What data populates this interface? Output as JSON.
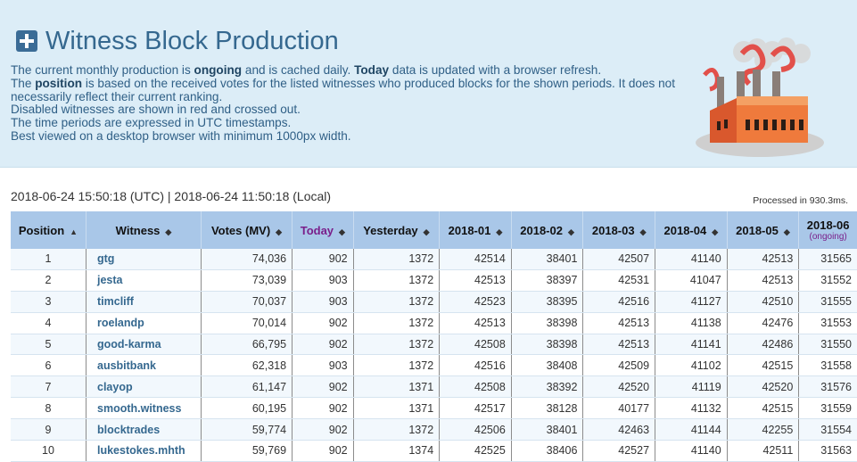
{
  "header": {
    "title": "Witness Block Production",
    "intro": {
      "line1_a": "The current monthly production is ",
      "line1_b": "ongoing",
      "line1_c": " and is cached daily. ",
      "line1_d": "Today",
      "line1_e": " data is updated with a browser refresh.",
      "line2_a": "The ",
      "line2_b": "position",
      "line2_c": " is based on the received votes for the listed witnesses who produced blocks for the shown periods. It does not necessarily reflect their current ranking.",
      "line3": "Disabled witnesses are shown in red and crossed out.",
      "line4": "The time periods are expressed in UTC timestamps.",
      "line5": "Best viewed on a desktop browser with minimum 1000px width."
    }
  },
  "timestamp": "2018-06-24 15:50:18 (UTC) | 2018-06-24 11:50:18 (Local)",
  "processed": "Processed in 930.3ms.",
  "table": {
    "columns": {
      "position": "Position",
      "witness": "Witness",
      "votes": "Votes (MV)",
      "today": "Today",
      "yesterday": "Yesterday",
      "m1": "2018-01",
      "m2": "2018-02",
      "m3": "2018-03",
      "m4": "2018-04",
      "m5": "2018-05",
      "m6": "2018-06",
      "m6_note": "(ongoing)"
    },
    "rows": [
      {
        "pos": "1",
        "witness": "gtg",
        "votes": "74,036",
        "today": "902",
        "yesterday": "1372",
        "m1": "42514",
        "m2": "38401",
        "m3": "42507",
        "m4": "41140",
        "m5": "42513",
        "m6": "31565"
      },
      {
        "pos": "2",
        "witness": "jesta",
        "votes": "73,039",
        "today": "903",
        "yesterday": "1372",
        "m1": "42513",
        "m2": "38397",
        "m3": "42531",
        "m4": "41047",
        "m5": "42513",
        "m6": "31552"
      },
      {
        "pos": "3",
        "witness": "timcliff",
        "votes": "70,037",
        "today": "903",
        "yesterday": "1372",
        "m1": "42523",
        "m2": "38395",
        "m3": "42516",
        "m4": "41127",
        "m5": "42510",
        "m6": "31555"
      },
      {
        "pos": "4",
        "witness": "roelandp",
        "votes": "70,014",
        "today": "902",
        "yesterday": "1372",
        "m1": "42513",
        "m2": "38398",
        "m3": "42513",
        "m4": "41138",
        "m5": "42476",
        "m6": "31553"
      },
      {
        "pos": "5",
        "witness": "good-karma",
        "votes": "66,795",
        "today": "902",
        "yesterday": "1372",
        "m1": "42508",
        "m2": "38398",
        "m3": "42513",
        "m4": "41141",
        "m5": "42486",
        "m6": "31550"
      },
      {
        "pos": "6",
        "witness": "ausbitbank",
        "votes": "62,318",
        "today": "903",
        "yesterday": "1372",
        "m1": "42516",
        "m2": "38408",
        "m3": "42509",
        "m4": "41102",
        "m5": "42515",
        "m6": "31558"
      },
      {
        "pos": "7",
        "witness": "clayop",
        "votes": "61,147",
        "today": "902",
        "yesterday": "1371",
        "m1": "42508",
        "m2": "38392",
        "m3": "42520",
        "m4": "41119",
        "m5": "42520",
        "m6": "31576"
      },
      {
        "pos": "8",
        "witness": "smooth.witness",
        "votes": "60,195",
        "today": "902",
        "yesterday": "1371",
        "m1": "42517",
        "m2": "38128",
        "m3": "40177",
        "m4": "41132",
        "m5": "42515",
        "m6": "31559"
      },
      {
        "pos": "9",
        "witness": "blocktrades",
        "votes": "59,774",
        "today": "902",
        "yesterday": "1372",
        "m1": "42506",
        "m2": "38401",
        "m3": "42463",
        "m4": "41144",
        "m5": "42255",
        "m6": "31554"
      },
      {
        "pos": "10",
        "witness": "lukestokes.mhth",
        "votes": "59,769",
        "today": "902",
        "yesterday": "1374",
        "m1": "42525",
        "m2": "38406",
        "m3": "42527",
        "m4": "41140",
        "m5": "42511",
        "m6": "31563"
      }
    ]
  },
  "colors": {
    "header_bg": "#dcedf7",
    "title": "#35688f",
    "table_header_bg": "#a9c7e8",
    "link": "#35688f",
    "today_label": "#7a1f8a"
  }
}
